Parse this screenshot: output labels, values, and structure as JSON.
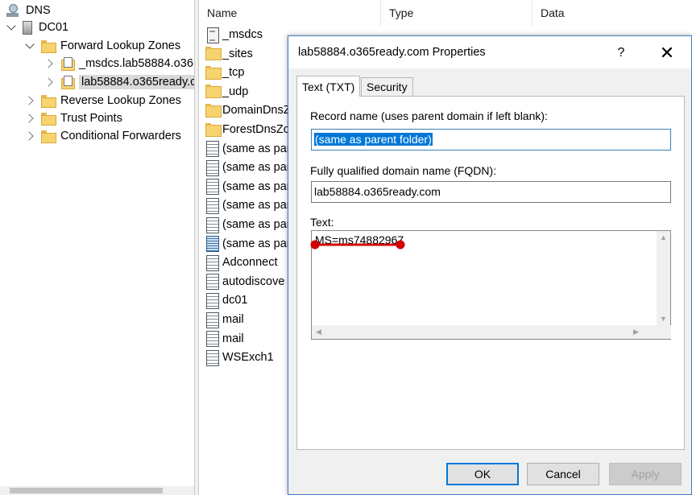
{
  "tree": {
    "root": "DNS",
    "server": "DC01",
    "forward_zones": "Forward Lookup Zones",
    "zone_msdcs": "_msdcs.lab58884.o36",
    "zone_main": "lab58884.o365ready.c",
    "reverse_zones": "Reverse Lookup Zones",
    "trust_points": "Trust Points",
    "conditional_forwarders": "Conditional Forwarders"
  },
  "list": {
    "columns": [
      "Name",
      "Type",
      "Data"
    ],
    "rows": [
      {
        "name": "_msdcs",
        "icon": "zone-delegation-icon"
      },
      {
        "name": "_sites",
        "icon": "folder-icon"
      },
      {
        "name": "_tcp",
        "icon": "folder-icon"
      },
      {
        "name": "_udp",
        "icon": "folder-icon"
      },
      {
        "name": "DomainDnsZ",
        "icon": "folder-icon"
      },
      {
        "name": "ForestDnsZo",
        "icon": "folder-icon"
      },
      {
        "name": "(same as par",
        "icon": "record-icon"
      },
      {
        "name": "(same as par",
        "icon": "record-icon"
      },
      {
        "name": "(same as par",
        "icon": "record-icon"
      },
      {
        "name": "(same as par",
        "icon": "record-icon"
      },
      {
        "name": "(same as par",
        "icon": "record-icon"
      },
      {
        "name": "(same as par",
        "icon": "record-icon"
      },
      {
        "name": "Adconnect",
        "icon": "record-icon"
      },
      {
        "name": "autodiscove",
        "icon": "record-icon"
      },
      {
        "name": "dc01",
        "icon": "record-icon"
      },
      {
        "name": "mail",
        "icon": "record-icon"
      },
      {
        "name": "mail",
        "icon": "record-icon"
      },
      {
        "name": "WSExch1",
        "icon": "record-icon"
      }
    ]
  },
  "dialog": {
    "title": "lab58884.o365ready.com Properties",
    "help_label": "?",
    "close_label": "✕",
    "tabs": [
      "Text (TXT)",
      "Security"
    ],
    "record_name_label": "Record name (uses parent domain if left blank):",
    "record_name_value": "(same as parent folder)",
    "fqdn_label": "Fully qualified domain name (FQDN):",
    "fqdn_value": "lab58884.o365ready.com",
    "text_label": "Text:",
    "text_value": "MS=ms74882967",
    "ok_label": "OK",
    "cancel_label": "Cancel",
    "apply_label": "Apply"
  },
  "colors": {
    "selection": "#0078d7",
    "annotation": "#d00000",
    "dialog_border": "#3b7bc4"
  }
}
